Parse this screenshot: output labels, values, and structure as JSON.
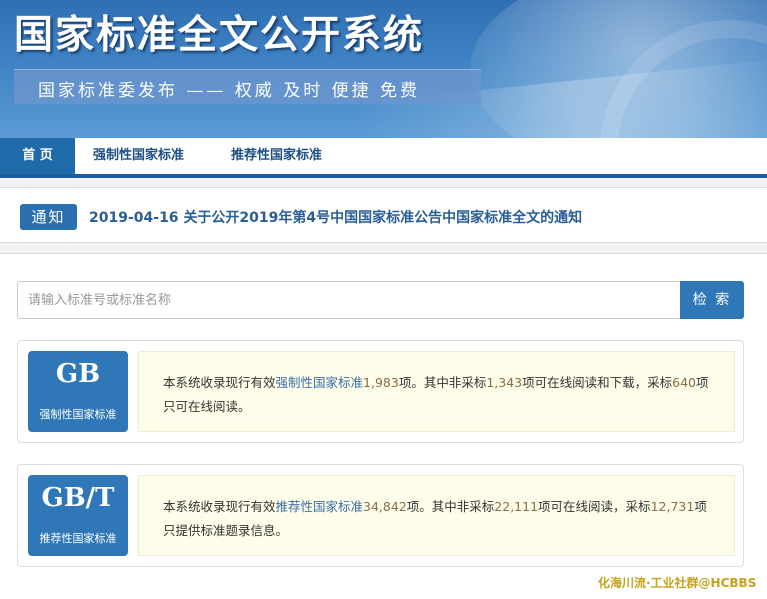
{
  "header": {
    "title": "国家标准全文公开系统",
    "slogan": "国家标准委发布 —— 权威 及时 便捷 免费"
  },
  "nav": {
    "items": [
      {
        "label": "首 页",
        "active": true
      },
      {
        "label": "强制性国家标准"
      },
      {
        "label": "推荐性国家标准"
      }
    ]
  },
  "notice": {
    "tag": "通知",
    "date": "2019-04-16",
    "text": "关于公开2019年第4号中国国家标准公告中国家标准全文的通知"
  },
  "search": {
    "placeholder": "请输入标准号或标准名称",
    "button_label": "检 索"
  },
  "cards": [
    {
      "code": "GB",
      "label": "强制性国家标准",
      "desc_prefix": "本系统收录现行有效",
      "desc_link": "强制性国家标准",
      "total": "1,983",
      "desc_mid1": "项。其中非采标",
      "non_adopted": "1,343",
      "desc_mid2": "项可在线阅读和下载，采标",
      "adopted": "640",
      "desc_suffix": "项只可在线阅读。"
    },
    {
      "code": "GB/T",
      "label": "推荐性国家标准",
      "desc_prefix": "本系统收录现行有效",
      "desc_link": "推荐性国家标准",
      "total": "34,842",
      "desc_mid1": "项。其中非采标",
      "non_adopted": "22,111",
      "desc_mid2": "项可在线阅读，采标",
      "adopted": "12,731",
      "desc_suffix": "项只提供标准题录信息。"
    }
  ],
  "watermark": {
    "text": "化海川流·工业社群@HCBBS"
  },
  "colors": {
    "primary": "#2f77b7",
    "nav_border": "#1e5c9a",
    "highlight": "#8a6d4a",
    "desc_bg": "#fdfde9"
  }
}
